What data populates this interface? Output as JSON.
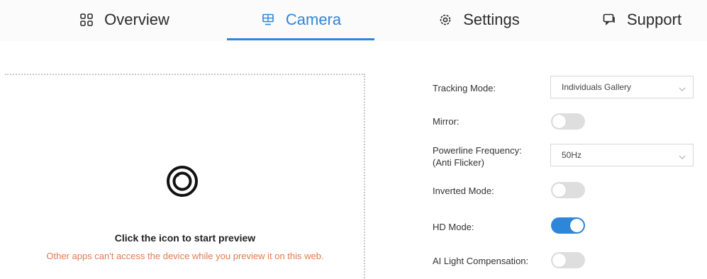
{
  "tabs": [
    {
      "label": "Overview",
      "icon": "grid-icon",
      "active": false
    },
    {
      "label": "Camera",
      "icon": "monitor-icon",
      "active": true
    },
    {
      "label": "Settings",
      "icon": "gear-icon",
      "active": false
    },
    {
      "label": "Support",
      "icon": "chat-icon",
      "active": false
    }
  ],
  "preview": {
    "icon": "camera-lens-icon",
    "title": "Click the icon to start preview",
    "warning": "Other apps can't access the device while you preview it on this web."
  },
  "settings": {
    "tracking_mode": {
      "label": "Tracking Mode:",
      "value": "Individuals Gallery"
    },
    "mirror": {
      "label": "Mirror:",
      "on": false
    },
    "powerline": {
      "label_line1": "Powerline Frequency:",
      "label_line2": "(Anti Flicker)",
      "value": "50Hz"
    },
    "inverted": {
      "label": "Inverted Mode:",
      "on": false
    },
    "hd_mode": {
      "label": "HD Mode:",
      "on": true
    },
    "ai_light": {
      "label": "AI Light Compensation:",
      "on": false
    }
  },
  "colors": {
    "accent": "#2e86d9",
    "warning": "#e57a4e",
    "toggle_off": "#dedede"
  }
}
